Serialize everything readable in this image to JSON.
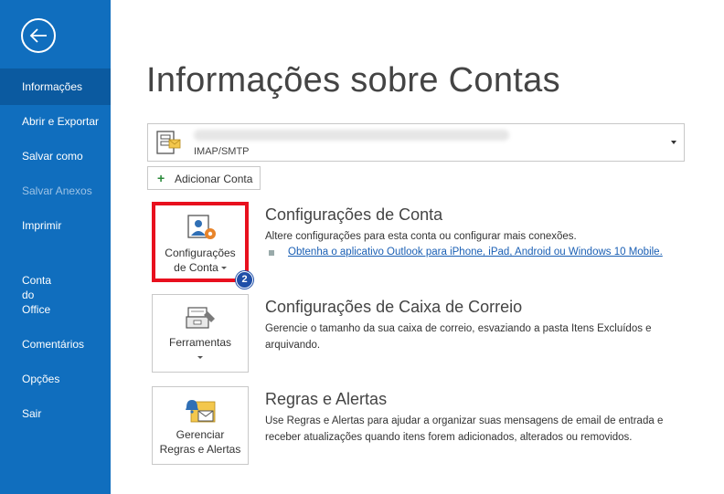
{
  "sidebar": {
    "items": [
      {
        "label": "Informações"
      },
      {
        "label": "Abrir e Exportar"
      },
      {
        "label": "Salvar como"
      },
      {
        "label": "Salvar Anexos"
      },
      {
        "label": "Imprimir"
      },
      {
        "label": "Conta\ndo\nOffice"
      },
      {
        "label": "Comentários"
      },
      {
        "label": "Opções"
      },
      {
        "label": "Sair"
      }
    ],
    "active_index": 0,
    "disabled_index": 3
  },
  "main": {
    "title": "Informações sobre Contas",
    "account": {
      "type": "IMAP/SMTP"
    },
    "add_account_label": "Adicionar Conta",
    "sections": [
      {
        "tile_line1": "Configurações",
        "tile_line2": "de Conta",
        "title": "Configurações de Conta",
        "description": "Altere configurações para esta conta ou configurar mais conexões.",
        "link": "Obtenha o aplicativo Outlook para iPhone, iPad, Android ou Windows 10 Mobile.",
        "badge": "2"
      },
      {
        "tile_line1": "Ferramentas",
        "title": "Configurações de Caixa de Correio",
        "description": "Gerencie o tamanho da sua caixa de correio, esvaziando a pasta Itens Excluídos e arquivando."
      },
      {
        "tile_line1": "Gerenciar",
        "tile_line2": "Regras e Alertas",
        "title": "Regras e Alertas",
        "description": "Use Regras e Alertas para ajudar a organizar suas mensagens de email de entrada e receber atualizações quando itens forem adicionados, alterados ou removidos."
      }
    ]
  },
  "colors": {
    "sidebar": "#106ebe",
    "sidebar_active": "#0b5aa0",
    "highlight": "#e8101e",
    "badge": "#1f4fa8",
    "link": "#1a5fb4"
  }
}
